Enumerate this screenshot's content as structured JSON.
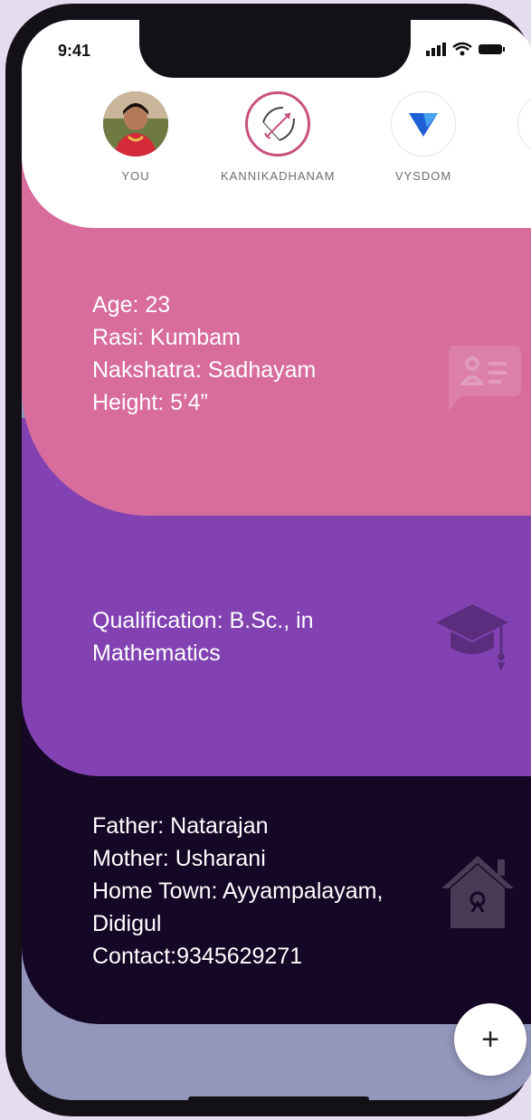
{
  "status_bar": {
    "time": "9:41"
  },
  "stories": [
    {
      "label": "YOU",
      "icon": "profile-photo"
    },
    {
      "label": "KANNIKADHANAM",
      "icon": "bow-arrow-icon"
    },
    {
      "label": "VYSDOM",
      "icon": "vysdom-logo-icon"
    }
  ],
  "basic_info": {
    "age": "Age: 23",
    "rasi": "Rasi: Kumbam",
    "nakshatra": "Nakshatra: Sadhayam",
    "height": "Height: 5’4”"
  },
  "education": {
    "line1": "Qualification: B.Sc., in",
    "line2": "Mathematics"
  },
  "family": {
    "father": "Father: Natarajan",
    "mother": "Mother: Usharani",
    "hometown1": "Home Town: Ayyampalayam,",
    "hometown2": "Didigul",
    "contact": "Contact:9345629271"
  },
  "colors": {
    "pink_card": "#d76c9d",
    "purple_card": "#8242b2",
    "dark_card": "#150726",
    "bottom_bg": "#9397bb"
  },
  "fab": {
    "label": "+"
  }
}
